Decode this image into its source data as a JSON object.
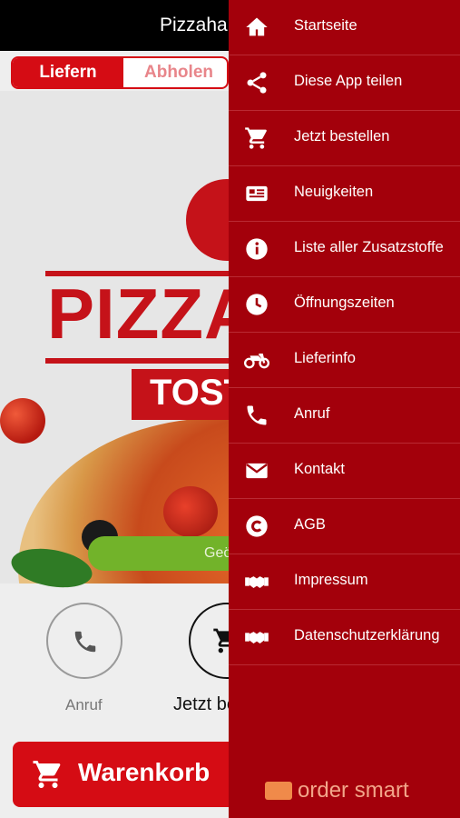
{
  "header": {
    "title": "Pizzahaus Tosto"
  },
  "segment": {
    "deliver": "Liefern",
    "pickup": "Abholen"
  },
  "hero": {
    "logo_main": "PIZZAHAUS",
    "logo_sub": "TOSTO",
    "open_status": "Geöffnet"
  },
  "quick": {
    "call_label": "Anruf",
    "order_label": "Jetzt bestellen"
  },
  "cart": {
    "label": "Warenkorb"
  },
  "drawer": {
    "items": [
      {
        "label": "Startseite",
        "icon": "home-icon"
      },
      {
        "label": "Diese App teilen",
        "icon": "share-icon"
      },
      {
        "label": "Jetzt bestellen",
        "icon": "cart-icon"
      },
      {
        "label": "Neuigkeiten",
        "icon": "news-icon"
      },
      {
        "label": "Liste aller Zusatzstoffe",
        "icon": "info-icon"
      },
      {
        "label": "Öffnungszeiten",
        "icon": "clock-icon"
      },
      {
        "label": "Lieferinfo",
        "icon": "motorbike-icon"
      },
      {
        "label": "Anruf",
        "icon": "phone-icon"
      },
      {
        "label": "Kontakt",
        "icon": "envelope-icon"
      },
      {
        "label": "AGB",
        "icon": "copyright-icon"
      },
      {
        "label": "Impressum",
        "icon": "handshake-icon"
      },
      {
        "label": "Datenschutzerklärung",
        "icon": "handshake-icon"
      }
    ],
    "brand": "order smart"
  },
  "colors": {
    "brand_red": "#d50c14",
    "drawer_red": "#a3000b",
    "open_green": "#72b32a"
  }
}
